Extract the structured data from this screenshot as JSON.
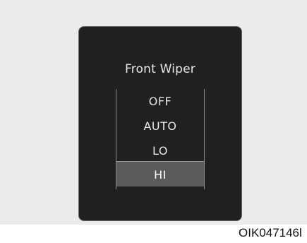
{
  "display": {
    "title": "Front Wiper",
    "options": [
      "OFF",
      "AUTO",
      "LO",
      "HI"
    ],
    "selected_option": "HI"
  },
  "figure_code": "OIK047146l",
  "colors": {
    "screen_background": "#202020",
    "selected_highlight": "#5a5a5a",
    "text": "#e6e6e6",
    "page_background": "#ebebeb"
  }
}
